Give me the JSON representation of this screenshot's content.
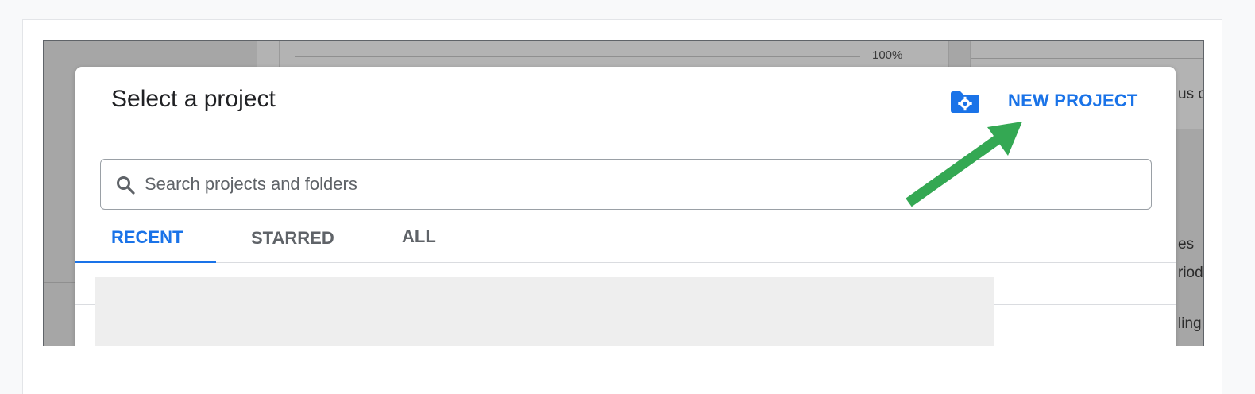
{
  "background_console": {
    "progress_label": "100%",
    "progress": 1.0,
    "partial_texts": [
      "us c",
      "es",
      "riod",
      "ling"
    ]
  },
  "dialog": {
    "title": "Select a project",
    "folder_settings_icon": "folder-gear-icon",
    "new_project_label": "NEW PROJECT",
    "search": {
      "placeholder": "Search projects and folders",
      "value": "",
      "icon": "search-icon"
    },
    "tabs": [
      {
        "label": "RECENT",
        "active": true
      },
      {
        "label": "STARRED",
        "active": false
      },
      {
        "label": "ALL",
        "active": false
      }
    ]
  },
  "annotation": {
    "arrow_color": "#34a853",
    "points_to": "new-project-button"
  },
  "colors": {
    "accent": "#1a73e8",
    "title_text": "#202124",
    "secondary_text": "#5f6368",
    "overlay": "#a6a6a6"
  }
}
